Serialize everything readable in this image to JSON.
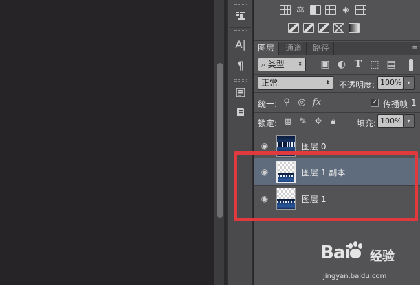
{
  "layers_panel": {
    "tabs": [
      {
        "label": "图层",
        "active": true
      },
      {
        "label": "通道",
        "active": false
      },
      {
        "label": "路径",
        "active": false
      }
    ],
    "filter": {
      "kind_label": "类型"
    },
    "blend_mode": "正常",
    "opacity_label": "不透明度:",
    "opacity_value": "100%",
    "unify_label": "统一:",
    "propagate_label": "传播帧",
    "propagate_value": "1",
    "lock_label": "锁定:",
    "fill_label": "填充:",
    "fill_value": "100%",
    "layers": [
      {
        "name": "图层 0",
        "thumbnail": "sky",
        "visible": true,
        "selected": false
      },
      {
        "name": "图层 1 副本",
        "thumbnail": "checker",
        "visible": true,
        "selected": true
      },
      {
        "name": "图层 1",
        "thumbnail": "checker",
        "visible": true,
        "selected": false
      }
    ]
  },
  "toolstrip": {
    "icons": [
      "stamp-icon",
      "character-icon",
      "paragraph-icon",
      "notes-icon",
      "document-icon"
    ],
    "character_glyph": "A|",
    "paragraph_glyph": "¶"
  },
  "watermark": {
    "logo": "Bai",
    "logo_suffix": "经验",
    "url": "jingyan.baidu.com"
  },
  "colors": {
    "accent_highlight": "#e03a3f",
    "selected_row": "#5f6c7d",
    "panel_bg": "#535254"
  }
}
